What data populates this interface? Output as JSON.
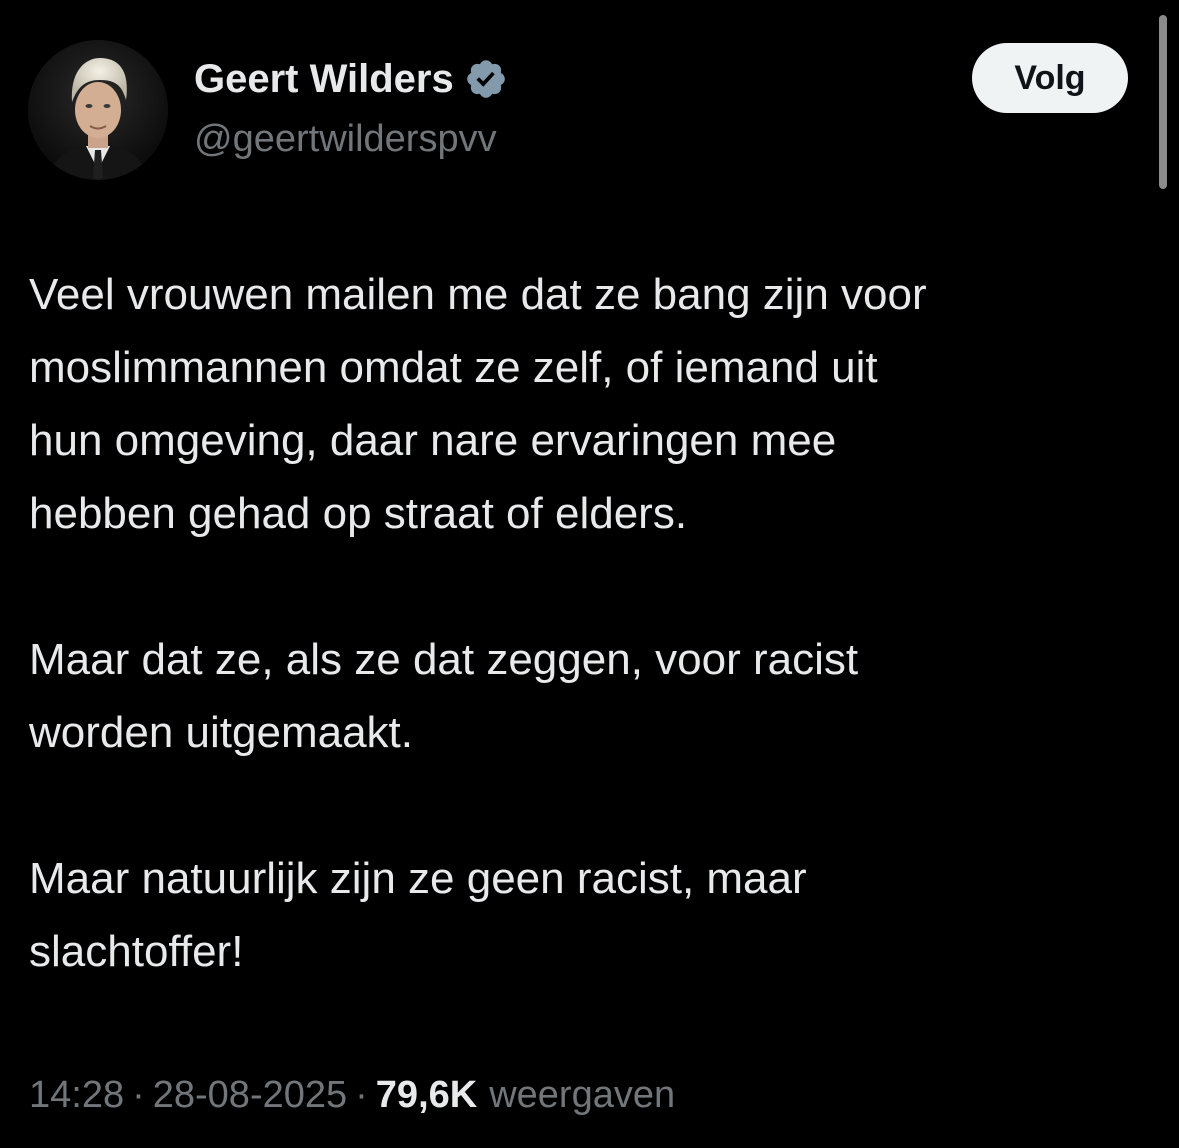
{
  "author": {
    "display_name": "Geert Wilders",
    "handle": "@geertwilderspvv",
    "verified": true,
    "verified_color": "#829aab"
  },
  "follow_button": {
    "label": "Volg"
  },
  "tweet": {
    "paragraphs": [
      {
        "lines": [
          "Veel vrouwen mailen me dat ze bang zijn voor",
          "moslimmannen omdat ze zelf, of iemand uit",
          "hun omgeving, daar nare ervaringen mee",
          "hebben gehad op straat of elders."
        ]
      },
      {
        "lines": [
          "Maar dat ze, als ze dat zeggen, voor racist",
          "worden uitgemaakt."
        ]
      },
      {
        "lines": [
          "Maar natuurlijk zijn ze geen racist, maar",
          "slachtoffer!"
        ]
      }
    ]
  },
  "meta": {
    "time": "14:28",
    "separator": "·",
    "date": "28-08-2025",
    "views_count": "79,6K",
    "views_label": "weergaven"
  },
  "colors": {
    "background": "#000000",
    "text_primary": "#e7e9ea",
    "text_secondary": "#71767b",
    "button_bg": "#eff3f4",
    "button_text": "#0f1419"
  }
}
